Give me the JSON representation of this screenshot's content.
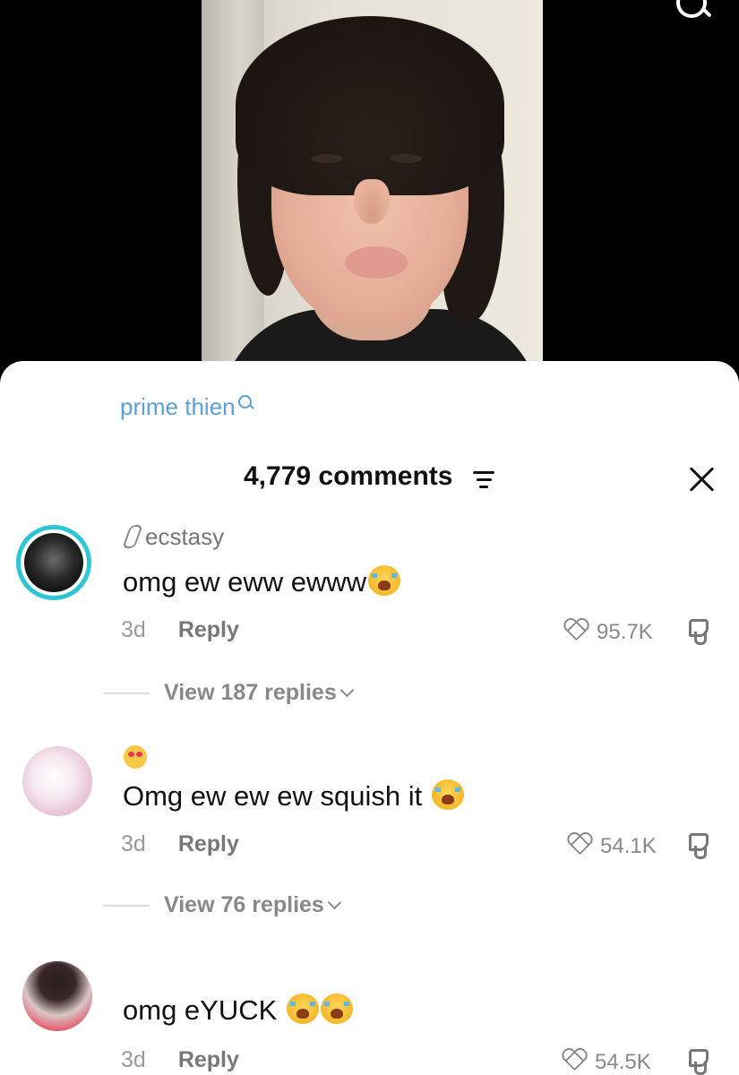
{
  "search_suggestion": "prime thien",
  "header": {
    "comment_count_label": "4,779 comments"
  },
  "comments": [
    {
      "username": "ecstasy",
      "text": "omg ew eww ewww",
      "time": "3d",
      "reply_label": "Reply",
      "likes": "95.7K",
      "view_replies": "View 187 replies"
    },
    {
      "username": "",
      "text": "Omg ew ew ew squish it ",
      "time": "3d",
      "reply_label": "Reply",
      "likes": "54.1K",
      "view_replies": "View 76 replies"
    },
    {
      "username": "",
      "text": "omg eYUCK ",
      "time": "3d",
      "reply_label": "Reply",
      "likes": "54.5K"
    }
  ],
  "colors": {
    "search_link": "#5a9fd6",
    "story_ring": "#2dc6d6",
    "sheet_bg": "#ffffff",
    "background": "#000000"
  },
  "icons": [
    "search-icon",
    "filter-icon",
    "close-icon",
    "heart-icon",
    "dislike-icon",
    "crying-face-emoji",
    "heart-eyes-emoji",
    "chevron-down-icon"
  ]
}
